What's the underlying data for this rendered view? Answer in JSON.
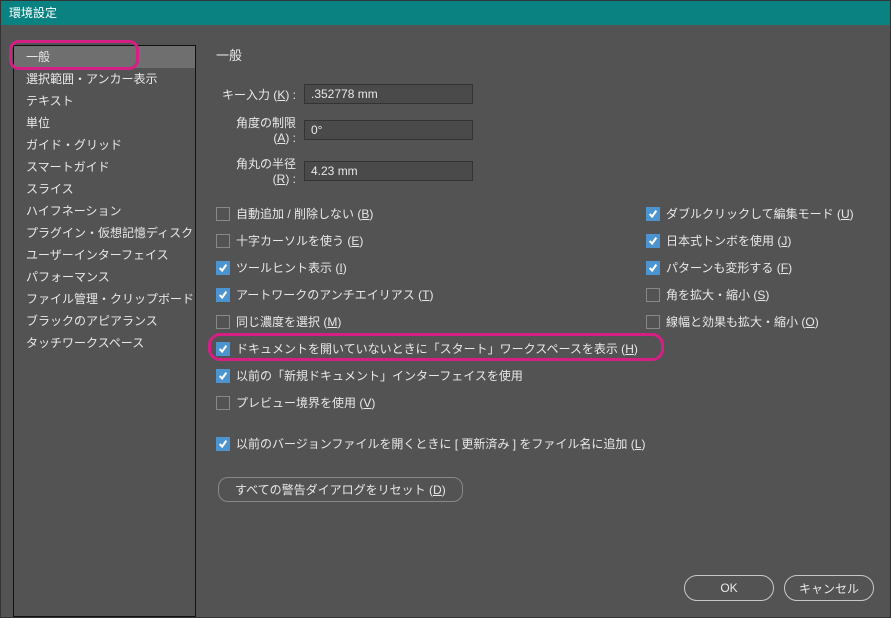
{
  "window": {
    "title": "環境設定"
  },
  "sidebar": {
    "items": [
      {
        "label": "一般",
        "selected": true
      },
      {
        "label": "選択範囲・アンカー表示"
      },
      {
        "label": "テキスト"
      },
      {
        "label": "単位"
      },
      {
        "label": "ガイド・グリッド"
      },
      {
        "label": "スマートガイド"
      },
      {
        "label": "スライス"
      },
      {
        "label": "ハイフネーション"
      },
      {
        "label": "プラグイン・仮想記憶ディスク"
      },
      {
        "label": "ユーザーインターフェイス"
      },
      {
        "label": "パフォーマンス"
      },
      {
        "label": "ファイル管理・クリップボード"
      },
      {
        "label": "ブラックのアピアランス"
      },
      {
        "label": "タッチワークスペース"
      }
    ]
  },
  "panel": {
    "title": "一般",
    "fields": {
      "key_input": {
        "label": "キー入力 (",
        "hotkey": "K",
        "suffix": ") :",
        "value": ".352778 mm"
      },
      "constrain_angle": {
        "label": "角度の制限 (",
        "hotkey": "A",
        "suffix": ") :",
        "value": "0°"
      },
      "corner_radius": {
        "label": "角丸の半径 (",
        "hotkey": "R",
        "suffix": ") :",
        "value": "4.23 mm"
      }
    },
    "checkboxes_left": [
      {
        "checked": false,
        "label": "自動追加 / 削除しない (",
        "hotkey": "B",
        "suffix": ")"
      },
      {
        "checked": false,
        "label": "十字カーソルを使う (",
        "hotkey": "E",
        "suffix": ")"
      },
      {
        "checked": true,
        "label": "ツールヒント表示 (",
        "hotkey": "I",
        "suffix": ")"
      },
      {
        "checked": true,
        "label": "アートワークのアンチエイリアス (",
        "hotkey": "T",
        "suffix": ")"
      },
      {
        "checked": false,
        "label": "同じ濃度を選択 (",
        "hotkey": "M",
        "suffix": ")"
      },
      {
        "checked": true,
        "label": "ドキュメントを開いていないときに「スタート」ワークスペースを表示 (",
        "hotkey": "H",
        "suffix": ")",
        "highlighted": true
      },
      {
        "checked": true,
        "label": "以前の「新規ドキュメント」インターフェイスを使用",
        "hotkey": "",
        "suffix": ""
      },
      {
        "checked": false,
        "label": "プレビュー境界を使用 (",
        "hotkey": "V",
        "suffix": ")"
      },
      {
        "checked": true,
        "label": "以前のバージョンファイルを開くときに [ 更新済み ] をファイル名に追加 (",
        "hotkey": "L",
        "suffix": ")"
      }
    ],
    "checkboxes_right": [
      {
        "checked": true,
        "label": "ダブルクリックして編集モード (",
        "hotkey": "U",
        "suffix": ")"
      },
      {
        "checked": true,
        "label": "日本式トンボを使用 (",
        "hotkey": "J",
        "suffix": ")"
      },
      {
        "checked": true,
        "label": "パターンも変形する (",
        "hotkey": "F",
        "suffix": ")"
      },
      {
        "checked": false,
        "label": "角を拡大・縮小 (",
        "hotkey": "S",
        "suffix": ")"
      },
      {
        "checked": false,
        "label": "線幅と効果も拡大・縮小 (",
        "hotkey": "O",
        "suffix": ")"
      }
    ],
    "reset_button": {
      "label": "すべての警告ダイアログをリセット (",
      "hotkey": "D",
      "suffix": ")"
    }
  },
  "footer": {
    "ok": "OK",
    "cancel": "キャンセル"
  }
}
